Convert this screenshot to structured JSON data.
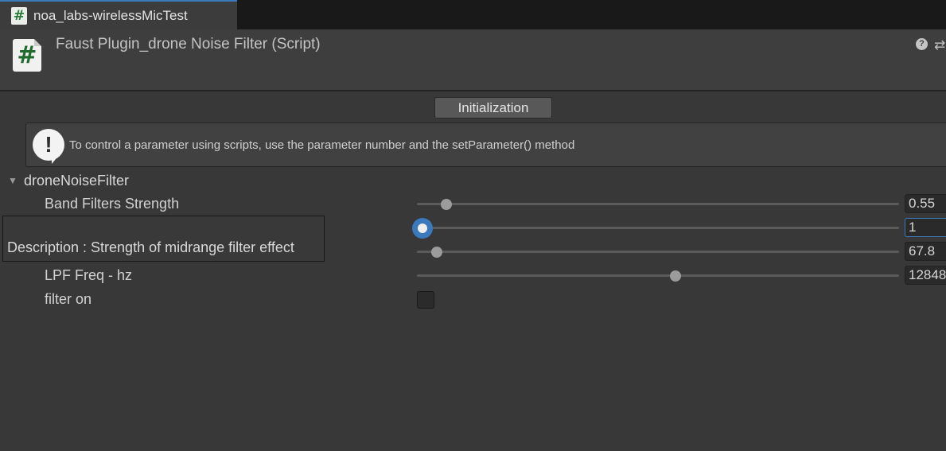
{
  "tab": {
    "label": "noa_labs-wirelessMicTest",
    "icon": "#"
  },
  "header": {
    "icon": "#",
    "title": "Faust Plugin_drone Noise Filter (Script)",
    "help_icon": "?",
    "settings_icon": "⇄"
  },
  "init_button": {
    "label": "Initialization"
  },
  "helpbox": {
    "icon": "!",
    "text": "To control a parameter using scripts, use the parameter number and the setParameter() method"
  },
  "foldout": {
    "arrow": "▼",
    "label": "droneNoiseFilter"
  },
  "params": [
    {
      "label": "Band Filters Strength",
      "value": "0.55",
      "level": 0.05
    },
    {
      "label": "",
      "value": "1",
      "level": 0.0
    },
    {
      "label": "",
      "value": "67.8",
      "level": 0.03
    },
    {
      "label": "LPF Freq - hz",
      "value": "12848",
      "level": 0.525
    }
  ],
  "toggle": {
    "label": "filter on",
    "checked": false
  },
  "tooltip": {
    "text": "Description : Strength of midrange filter effect"
  },
  "colors": {
    "accent": "#3a79bb",
    "background": "#383838",
    "script_icon": "#2d7a37"
  }
}
